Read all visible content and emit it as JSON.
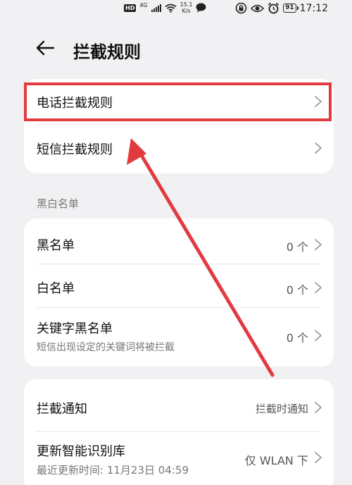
{
  "status_bar": {
    "hd": "HD",
    "network": "4G",
    "speed_value": "15.1",
    "speed_unit": "K/s",
    "battery": "91",
    "time": "17:12"
  },
  "header": {
    "title": "拦截规则"
  },
  "rules": {
    "phone_rules": "电话拦截规则",
    "sms_rules": "短信拦截规则"
  },
  "lists": {
    "section_title": "黑白名单",
    "blacklist_label": "黑名单",
    "blacklist_value": "0 个",
    "whitelist_label": "白名单",
    "whitelist_value": "0 个",
    "keyword_label": "关键字黑名单",
    "keyword_sub": "短信出现设定的关键词将被拦截",
    "keyword_value": "0 个"
  },
  "settings": {
    "notify_label": "拦截通知",
    "notify_value": "拦截时通知",
    "update_label": "更新智能识别库",
    "update_sub": "最近更新时间: 11月23日 04:59",
    "update_value": "仅 WLAN 下"
  },
  "colors": {
    "annotation": "#e23a3e",
    "background": "#f1f1f3",
    "card": "#ffffff"
  }
}
